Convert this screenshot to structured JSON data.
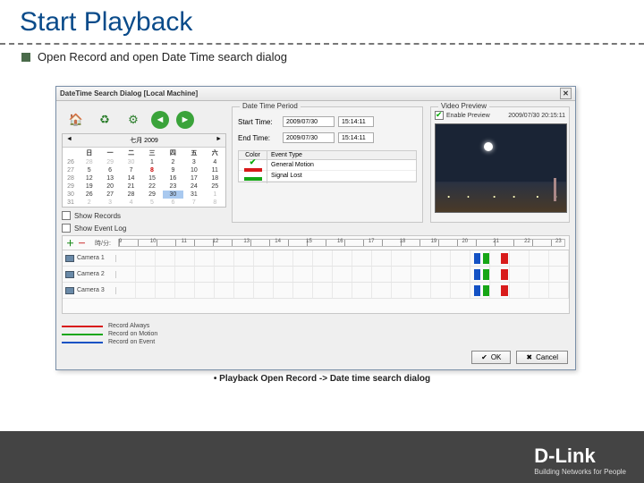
{
  "title": "Start Playback",
  "bullet": "Open Record and open Date Time search dialog",
  "dialog": {
    "title": "DateTime Search Dialog  [Local Machine]",
    "close": "✕",
    "period_label": "Date Time Period",
    "start_label": "Start Time:",
    "end_label": "End Time:",
    "start_date": "2009/07/30",
    "start_time": "15:14:11",
    "end_date": "2009/07/30",
    "end_time": "15:14:11",
    "event_color_h": "Color",
    "event_type_h": "Event Type",
    "event1": "General Motion",
    "event2": "Signal Lost",
    "show_records": "Show Records",
    "show_event_log": "Show Event Log",
    "preview_label": "Video Preview",
    "enable_preview": "Enable Preview",
    "preview_time": "2009/07/30 20:15:11",
    "cal_month": "七月 2009",
    "timeline_label": "時/分:",
    "cam1": "Camera 1",
    "cam2": "Camera 2",
    "cam3": "Camera 3",
    "legend1": "Record Always",
    "legend2": "Record on Motion",
    "legend3": "Record on Event",
    "ok": "OK",
    "cancel": "Cancel"
  },
  "cal": {
    "weeks": [
      "26",
      "27",
      "28",
      "29",
      "30",
      "31"
    ],
    "days": [
      [
        "28",
        "29",
        "30",
        "1",
        "2",
        "3",
        "4"
      ],
      [
        "5",
        "6",
        "7",
        "8",
        "9",
        "10",
        "11"
      ],
      [
        "12",
        "13",
        "14",
        "15",
        "16",
        "17",
        "18"
      ],
      [
        "19",
        "20",
        "21",
        "22",
        "23",
        "24",
        "25"
      ],
      [
        "26",
        "27",
        "28",
        "29",
        "30",
        "31",
        "1"
      ],
      [
        "2",
        "3",
        "4",
        "5",
        "6",
        "7",
        "8"
      ]
    ]
  },
  "ruler": [
    "9",
    "10",
    "11",
    "12",
    "13",
    "14",
    "15",
    "16",
    "17",
    "18",
    "19",
    "20",
    "21",
    "22",
    "23"
  ],
  "caption": "• Playback Open Record -> Date time search dialog",
  "brand": {
    "name": "D-Link",
    "tag": "Building Networks for People"
  }
}
